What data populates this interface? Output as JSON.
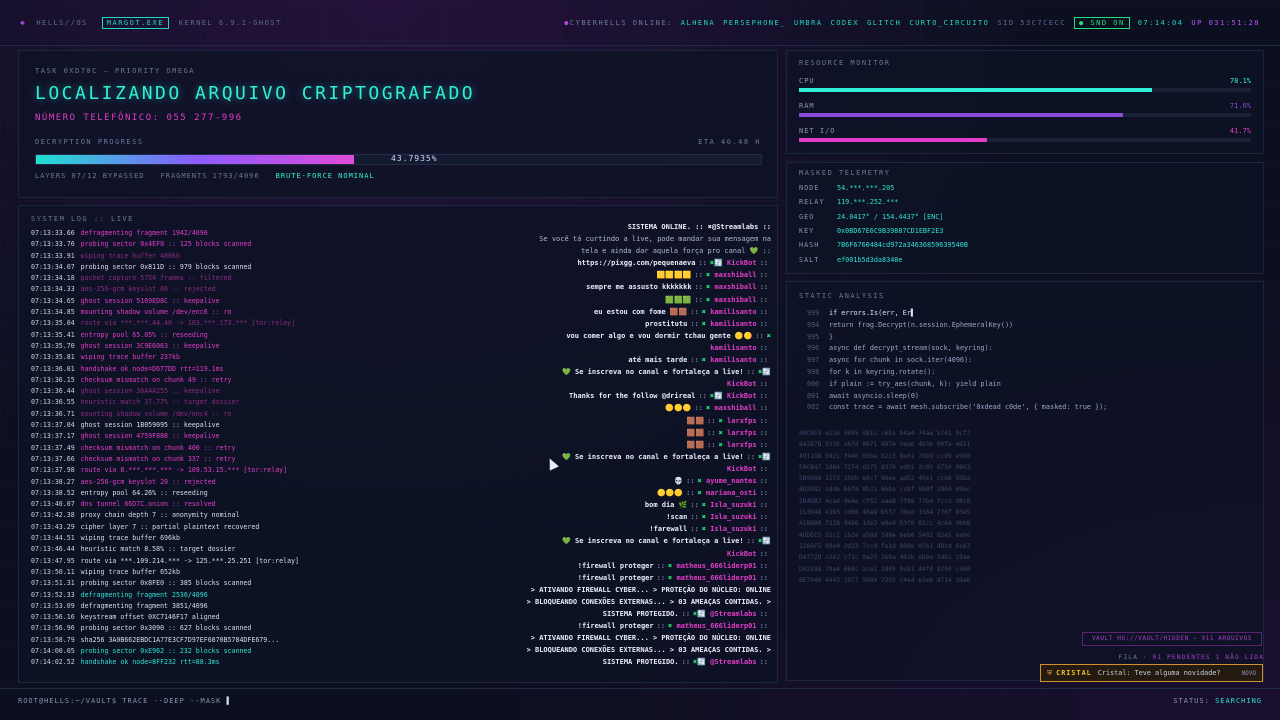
{
  "topbar": {
    "logo_icon": "diamond-icon",
    "brand": "HELLS//OS",
    "chip": "MARGOT.EXE",
    "kernel": "KERNEL 6.9.1-GHOST",
    "online_label": "CYBERHELLS ONLINE:",
    "users": [
      "ALHENA",
      "PERSEPHONE_",
      "UMBRA",
      "CODEX",
      "GLITCH",
      "CURTO_CIRCUITO"
    ],
    "sid": "SID 53C7CECC",
    "snd": "SND ON",
    "clock": "07:14:04",
    "uptime": "UP 031:51:28"
  },
  "task": {
    "id": "TASK 0XD70C — PRIORITY OMEGA",
    "title": "LOCALIZANDO ARQUIVO CRIPTOGRAFADO",
    "phone": "NÚMERO TELEFÔNICO: 055 277-996",
    "progress_label": "DECRYPTION PROGRESS",
    "eta": "ETA 40.48 H",
    "progress_pct": 43.7935,
    "progress_text": "43.7935%",
    "layers": "LAYERS 07/12 BYPASSED",
    "fragments": "FRAGMENTS 1793/4096",
    "brute": "BRUTE-FORCE NOMINAL"
  },
  "log": {
    "title": "SYSTEM LOG :: LIVE",
    "lines": [
      {
        "t": "07:13:33.66",
        "msg": "defragmenting fragment 1942/4096",
        "c": "p"
      },
      {
        "t": "07:13:33.76",
        "msg": "probing sector 0x4EF0 :: 125 blocks scanned",
        "c": "p"
      },
      {
        "t": "07:13:33.91",
        "msg": "wiping trace buffer 480kb",
        "c": "dp"
      },
      {
        "t": "07:13:34.07",
        "msg": "probing sector 0x811D :: 979 blocks scanned",
        "c": "w"
      },
      {
        "t": "07:13:34.18",
        "msg": "packet capture 5754 frames :: filtered",
        "c": "dp"
      },
      {
        "t": "07:13:34.33",
        "msg": "aes-256-gcm keyslot 06 :: rejected",
        "c": "dp"
      },
      {
        "t": "07:13:34.65",
        "msg": "ghost session 5169ED8C :: keepalive",
        "c": "p"
      },
      {
        "t": "07:13:34.85",
        "msg": "mounting shadow volume /dev/enc6 :: ro",
        "c": "p"
      },
      {
        "t": "07:13:35.04",
        "msg": "route via ***.***.44.40 -> 103.***.173.*** [tor:relay]",
        "c": "dp"
      },
      {
        "t": "07:13:35.41",
        "msg": "entropy pool 65.05% :: reseeding",
        "c": "p"
      },
      {
        "t": "07:13:35.70",
        "msg": "ghost session 3C9E6063 :: keepalive",
        "c": "p"
      },
      {
        "t": "07:13:35.81",
        "msg": "wiping trace buffer 237kb",
        "c": "p"
      },
      {
        "t": "07:13:36.01",
        "msg": "handshake ok node=D677DD rtt=119.1ms",
        "c": "p"
      },
      {
        "t": "07:13:36.15",
        "msg": "checksum mismatch on chunk 49 :: retry",
        "c": "p"
      },
      {
        "t": "07:13:36.44",
        "msg": "ghost session 36A4A255 :: keepalive",
        "c": "dp"
      },
      {
        "t": "07:13:36.55",
        "msg": "heuristic match 37.77% :: target dossier",
        "c": "dp"
      },
      {
        "t": "07:13:36.71",
        "msg": "mounting shadow volume /dev/enc4 :: ro",
        "c": "dp"
      },
      {
        "t": "07:13:37.04",
        "msg": "ghost session 1B059095 :: keepalive",
        "c": "w"
      },
      {
        "t": "07:13:37.17",
        "msg": "ghost session 4759F888 :: keepalive",
        "c": "p"
      },
      {
        "t": "07:13:37.49",
        "msg": "checksum mismatch on chunk 400 :: retry",
        "c": "p"
      },
      {
        "t": "07:13:37.66",
        "msg": "checksum mismatch on chunk 337 :: retry",
        "c": "p"
      },
      {
        "t": "07:13:37.98",
        "msg": "route via 8.***.***.*** -> 109.53.15.*** [tor:relay]",
        "c": "p"
      },
      {
        "t": "07:13:38.27",
        "msg": "aes-256-gcm keyslot 20 :: rejected",
        "c": "p"
      },
      {
        "t": "07:13:38.52",
        "msg": "entropy pool 64.26% :: reseeding",
        "c": "w"
      },
      {
        "t": "07:13:40.07",
        "msg": "dns tunnel 66D7C.onion :: resolved",
        "c": "p"
      },
      {
        "t": "07:13:42.38",
        "msg": "proxy chain depth 7 :: anonymity nominal",
        "c": "w"
      },
      {
        "t": "07:13:43.29",
        "msg": "cipher layer 7 :: partial plaintext recovered",
        "c": "w"
      },
      {
        "t": "07:13:44.51",
        "msg": "wiping trace buffer 696kb",
        "c": "w"
      },
      {
        "t": "07:13:46.44",
        "msg": "heuristic match 8.58% :: target dossier",
        "c": "w"
      },
      {
        "t": "07:13:47.95",
        "msg": "route via ***.109.214.*** -> 125.***.25.251 [tor:relay]",
        "c": "w"
      },
      {
        "t": "07:13:50.11",
        "msg": "wiping trace buffer 652kb",
        "c": "w"
      },
      {
        "t": "07:13:51.31",
        "msg": "probing sector 0x8FE0 :: 385 blocks scanned",
        "c": "w"
      },
      {
        "t": "07:13:52.33",
        "msg": "defragmenting fragment 2536/4096",
        "c": "c"
      },
      {
        "t": "07:13:53.09",
        "msg": "defragmenting fragment 3851/4096",
        "c": "w"
      },
      {
        "t": "07:13:56.16",
        "msg": "keystream offset 0XC7146F17 aligned",
        "c": "w"
      },
      {
        "t": "07:13:56.96",
        "msg": "probing sector 0x3090 :: 627 blocks scanned",
        "c": "w"
      },
      {
        "t": "07:13:58.79",
        "msg": "sha256 3A0B662EBDC1A77E3CF7D97EF6870B5784DFE679...",
        "c": "w"
      },
      {
        "t": "07:14:00.05",
        "msg": "probing sector 0xE962 :: 232 blocks scanned",
        "c": "c"
      },
      {
        "t": "07:14:02.52",
        "msg": "handshake ok node=8FF232 rtt=88.3ms",
        "c": "c"
      }
    ]
  },
  "chat": {
    "messages": [
      {
        "type": "sys",
        "text": "SISTEMA ONLINE. :: ✖@Streamlabs ::"
      },
      {
        "type": "plain",
        "text": "Se você tá curtindo a live, pode mandar sua mensagem na"
      },
      {
        "type": "plain",
        "text": "tela e ainda dar aquela força pro canal 💚 ::"
      },
      {
        "type": "msg",
        "text": "https://pixgg.com/pequenaeva",
        "user": "KickBot",
        "badge": "✖🔄"
      },
      {
        "type": "msg",
        "text": "🟨🟨🟨🟨",
        "user": "maxshiball",
        "badge": "✖"
      },
      {
        "type": "msg",
        "text": "sempre me assusto kkkkkkk",
        "user": "maxshiball",
        "badge": "✖"
      },
      {
        "type": "msg",
        "text": "🟩🟩🟩",
        "user": "maxshiball",
        "badge": "✖"
      },
      {
        "type": "msg",
        "text": "eu estou com fome 🟫🟫",
        "user": "kamilisanto",
        "badge": "✖"
      },
      {
        "type": "msg",
        "text": "prostitutu",
        "user": "kamilisanto",
        "badge": "✖"
      },
      {
        "type": "msg",
        "text": "vou comer algo e vou dormir tchau gente 🟡🟡",
        "user": "",
        "badge": "✖"
      },
      {
        "type": "msg",
        "text": "",
        "user": "kamilisanto",
        "badge": ""
      },
      {
        "type": "msg",
        "text": "até mais tarde",
        "user": "kamilisanto",
        "badge": "✖"
      },
      {
        "type": "sub",
        "text": "💚 Se inscreva no canal e fortaleça a live!",
        "user": "",
        "badge": "✖🔄"
      },
      {
        "type": "msg",
        "text": "",
        "user": "KickBot",
        "badge": ""
      },
      {
        "type": "msg",
        "text": "Thanks for the follow @drireal",
        "user": "KickBot",
        "badge": "✖🔄"
      },
      {
        "type": "msg",
        "text": "🟡🟡🟡",
        "user": "maxshiball",
        "badge": "✖"
      },
      {
        "type": "msg",
        "text": "🟫🟫",
        "user": "larxfps",
        "badge": "✖"
      },
      {
        "type": "msg",
        "text": "🟫🟫",
        "user": "larxfps",
        "badge": "✖"
      },
      {
        "type": "msg",
        "text": "🟫🟫",
        "user": "larxfps",
        "badge": "✖"
      },
      {
        "type": "sub",
        "text": "💚 Se inscreva no canal e fortaleça a live!",
        "user": "",
        "badge": "✖🔄"
      },
      {
        "type": "msg",
        "text": "",
        "user": "KickBot",
        "badge": ""
      },
      {
        "type": "msg",
        "text": "💀",
        "user": "ayume_nantes",
        "badge": "✖"
      },
      {
        "type": "msg",
        "text": "🟡🟡🟡",
        "user": "mariana_osti",
        "badge": "✖"
      },
      {
        "type": "msg",
        "text": "bom dia 🌿",
        "user": "Isla_suzuki",
        "badge": "✖"
      },
      {
        "type": "msg",
        "text": "!scan",
        "user": "Isla_suzuki",
        "badge": "✖"
      },
      {
        "type": "msg",
        "text": "!farewall",
        "user": "Isla_suzuki",
        "badge": "✖"
      },
      {
        "type": "sub",
        "text": "💚 Se inscreva no canal e fortaleça a live!",
        "user": "",
        "badge": "✖🔄"
      },
      {
        "type": "msg",
        "text": "",
        "user": "KickBot",
        "badge": ""
      },
      {
        "type": "msg",
        "text": "!firewall proteger",
        "user": "matheus_666liderp01",
        "badge": "✖"
      },
      {
        "type": "msg",
        "text": "!firewall proteger",
        "user": "matheus_666liderp01",
        "badge": "✖"
      },
      {
        "type": "sys",
        "text": "> ATIVANDO FIREWALL CYBER... > PROTEÇÃO DO NÚCLEO: ONLINE"
      },
      {
        "type": "sys",
        "text": "> BLOQUEANDO CONEXÕES EXTERNAS... > 03 AMEAÇAS CONTIDAS. >"
      },
      {
        "type": "msg",
        "text": "SISTEMA PROTEGIDO.",
        "user": "@Streamlabs",
        "badge": "✖🔄"
      },
      {
        "type": "msg",
        "text": "!firewall proteger",
        "user": "matheus_666liderp01",
        "badge": "✖"
      },
      {
        "type": "sys",
        "text": "> ATIVANDO FIREWALL CYBER... > PROTEÇÃO DO NÚCLEO: ONLINE"
      },
      {
        "type": "sys",
        "text": "> BLOQUEANDO CONEXÕES EXTERNAS... > 03 AMEAÇAS CONTIDAS. >"
      },
      {
        "type": "msg",
        "text": "SISTEMA PROTEGIDO.",
        "user": "@Streamlabs",
        "badge": "✖🔄"
      }
    ]
  },
  "resources": {
    "title": "RESOURCE MONITOR",
    "items": [
      {
        "label": "CPU",
        "value_text": "78.1%",
        "value": 78.1,
        "color": "#2ff0d6"
      },
      {
        "label": "RAM",
        "value_text": "71.6%",
        "value": 71.6,
        "color": "#8a4ad8"
      },
      {
        "label": "NET I/O",
        "value_text": "41.7%",
        "value": 41.7,
        "color": "#e23cc8"
      }
    ]
  },
  "telemetry": {
    "title": "MASKED TELEMETRY",
    "rows": [
      {
        "k": "NODE",
        "v": "54.***.***.205"
      },
      {
        "k": "RELAY",
        "v": "119.***.252.***"
      },
      {
        "k": "GEO",
        "v": "24.0417° / 154.4437° [ENC]"
      },
      {
        "k": "KEY",
        "v": "0x0BD67E6C9B39887CD1EBF2E3"
      },
      {
        "k": "HASH",
        "v": "7B6F6760484cd972a34636859639540B"
      },
      {
        "k": "SALT",
        "v": "ef001b5d3da8348e"
      }
    ]
  },
  "static": {
    "title": "STATIC ANALYSIS",
    "code": [
      {
        "n": "993",
        "x": "if errors.Is(err, Er▌"
      },
      {
        "n": "994",
        "x": "return frag.Decrypt(n.session.EphemeralKey())"
      },
      {
        "n": "995",
        "x": "}"
      },
      {
        "n": "996",
        "x": "async def decrypt_stream(sock, keyring):"
      },
      {
        "n": "997",
        "x": "async for chunk in sock.iter(4096):"
      },
      {
        "n": "998",
        "x": "for k in keyring.rotate():"
      },
      {
        "n": "000",
        "x": "if plain := try_aes(chunk, k): yield plain"
      },
      {
        "n": "001",
        "x": "await asyncio.sleep(0)"
      },
      {
        "n": "002",
        "x": "const trace = await mesh.subscribe('0xdead c0de', { masked: true });"
      }
    ],
    "hex": [
      "48C8E8 e13e 3655 d81c c6ba b4a4 74ae b741 9cf2",
      "8A2B7B 033b a6fd 0071 497e 5ea6 4b3b 00fa 4d21",
      "4911GB 592c f046 03be b2c3 8e01 75b9 cc95 e990",
      "FACB47 1d84 7274 d275 8370 ed01 3c05 6750 9863",
      "5B908A 1273 35bb e6cf 9bee ad52 40e1 ccb6 93ba",
      "8D2982 cdde b6f4 8b21 6bba ccbf 5b8f 396d 49ec",
      "2B4EB3 4ca4 de4e cf52 aae8 7f88 77b4 fcc3 d8c8",
      "153D48 4393 cd08 40a8 b557 70ed 1564 7f6f 85e5",
      "418880 f238 d486 1de3 e0e9 b3f0 82cc 4c84 9b08",
      "4DDEC5 32c2 1b2e a58d 3d8e beb0 5482 82e5 ea06",
      "1266F5 09e0 2d23 7ccd fe1d 008e 05b1 d8cd 6c63",
      "D4772D c2e2 c71c 0a25 2b6a 402b ebbe 5d61 19ae",
      "D0258A 79a4 068c ac61 3d05 9c01 d4fd 8750 c460",
      "8E7940 4443 2077 9d89 72b5 c4e4 e3eb d714 39a6"
    ]
  },
  "vault": "VAULT HG://VAULT/HIDDEN — 911 ARQUIVOS",
  "fila": {
    "label": "FILA ·",
    "pending": "01 PENDENTES",
    "extra": "1 NÃO LIDA"
  },
  "toast": {
    "icon": "shield-icon",
    "name": "CRISTAL",
    "text": "Cristal: Teve alguma novidade?",
    "tag": "NOVO"
  },
  "footer": {
    "cmd": "ROOT@HELLS:~/VAULT$ TRACE --DEEP --MASK",
    "status_label": "STATUS:",
    "status": "SEARCHING"
  }
}
